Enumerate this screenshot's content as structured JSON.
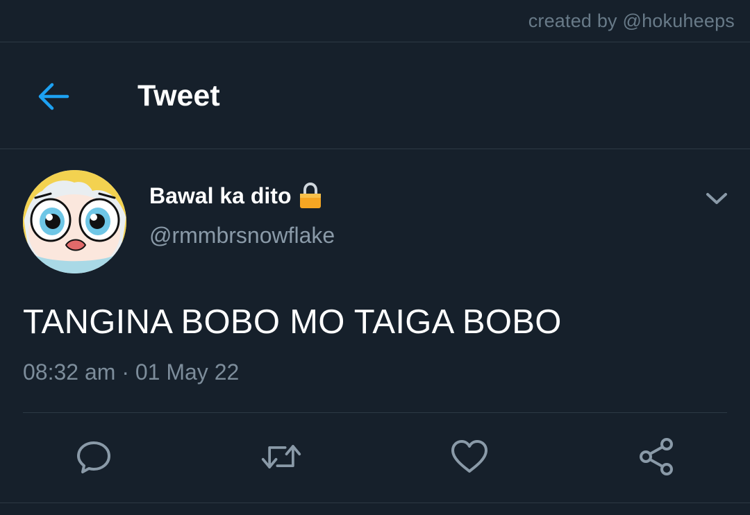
{
  "watermark": "created by @hokuheeps",
  "header": {
    "title": "Tweet",
    "back_icon": "arrow-left-icon"
  },
  "tweet": {
    "display_name": "Bawal ka dito",
    "lock_icon": "lock-icon",
    "handle": "@rmmbrsnowflake",
    "text": "TANGINA BOBO MO TAIGA BOBO",
    "time": "08:32 am",
    "separator": "·",
    "date": "01 May 22"
  },
  "actions": [
    {
      "name": "reply",
      "icon": "reply-icon"
    },
    {
      "name": "retweet",
      "icon": "retweet-icon"
    },
    {
      "name": "like",
      "icon": "heart-icon"
    },
    {
      "name": "share",
      "icon": "share-icon"
    }
  ],
  "colors": {
    "background": "#16202b",
    "accent": "#1da1f2",
    "secondary_text": "#8a9aa8",
    "lock": "#f5a623"
  }
}
